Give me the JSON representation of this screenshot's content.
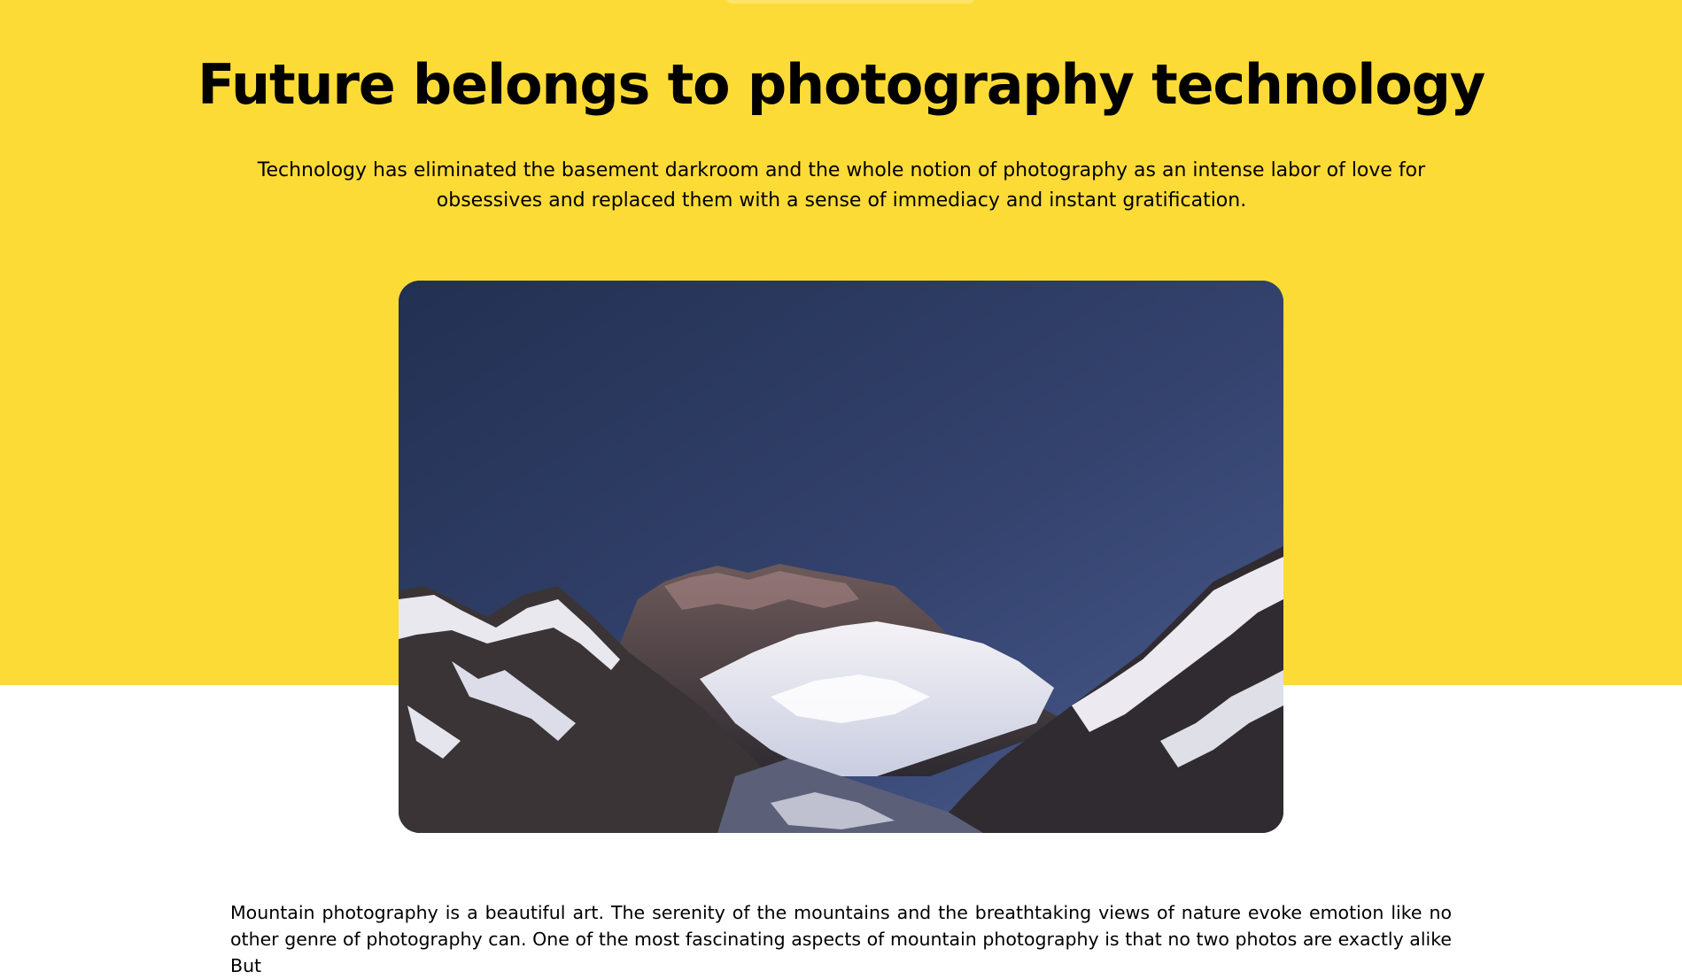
{
  "hero": {
    "title": "Future belongs to photography technology",
    "lead": "Technology has eliminated the basement darkroom and the whole notion of photography as an intense labor of love for obsessives and replaced them with a sense of immediacy and instant gratification.",
    "background_color": "#fddb37",
    "image_icon": "mountain-photo"
  },
  "article": {
    "paragraph": "Mountain photography is a beautiful art. The serenity of the mountains and the breathtaking views of nature evoke emotion like no other genre of photography can. One of the most fascinating aspects of mountain photography is that no two photos are exactly alike But"
  }
}
